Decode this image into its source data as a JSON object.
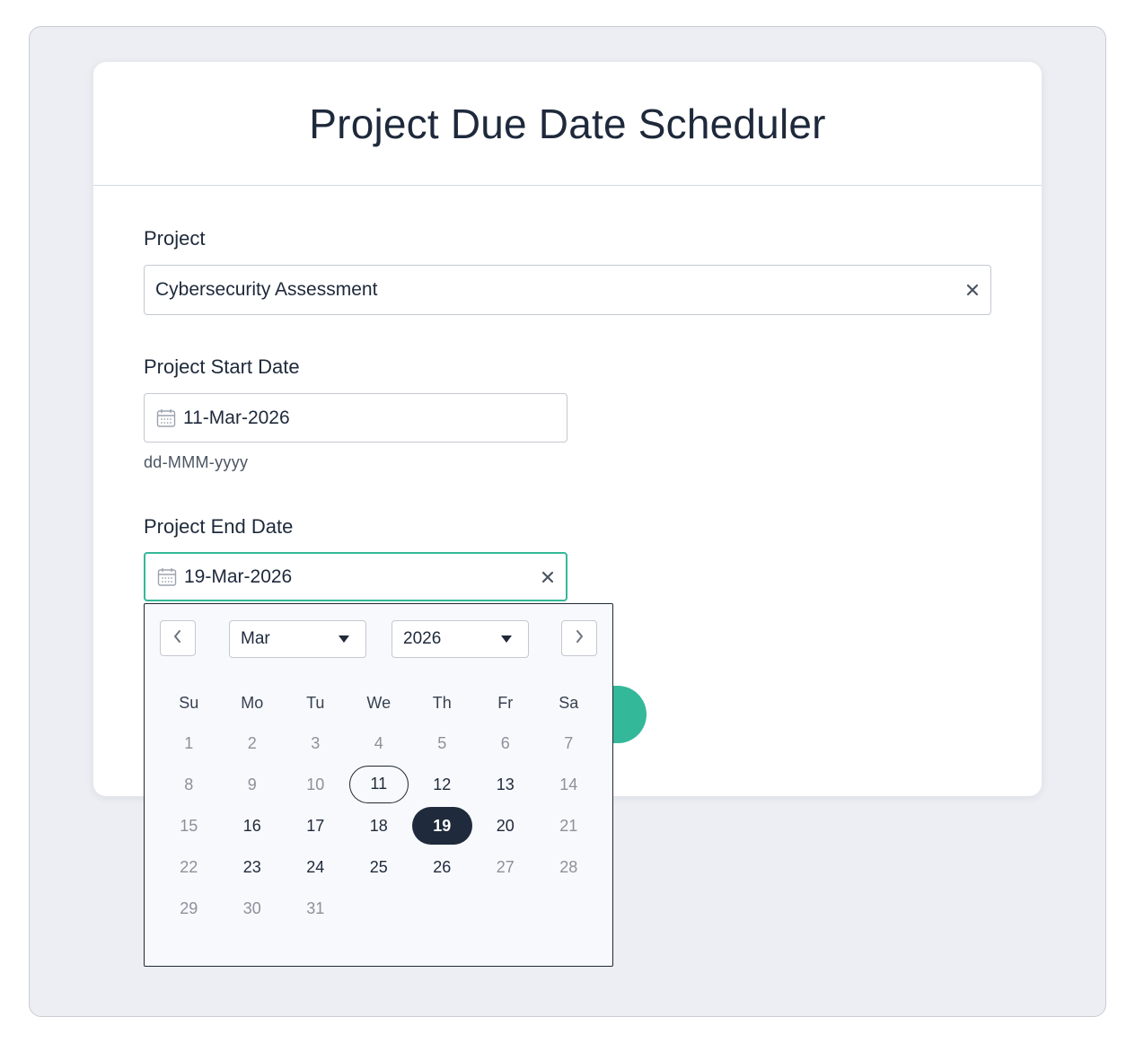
{
  "header": {
    "title": "Project Due Date Scheduler"
  },
  "form": {
    "project": {
      "label": "Project",
      "value": "Cybersecurity Assessment",
      "clear_icon": "close-icon"
    },
    "start_date": {
      "label": "Project Start Date",
      "value": "11-Mar-2026",
      "hint": "dd-MMM-yyyy",
      "icon": "calendar-icon"
    },
    "end_date": {
      "label": "Project End Date",
      "value": "19-Mar-2026",
      "icon": "calendar-icon",
      "clear_icon": "close-icon"
    }
  },
  "calendar": {
    "month": "Mar",
    "year": "2026",
    "weekdays": [
      "Su",
      "Mo",
      "Tu",
      "We",
      "Th",
      "Fr",
      "Sa"
    ],
    "weeks": [
      [
        {
          "d": "1",
          "s": "muted"
        },
        {
          "d": "2",
          "s": "muted"
        },
        {
          "d": "3",
          "s": "muted"
        },
        {
          "d": "4",
          "s": "muted"
        },
        {
          "d": "5",
          "s": "muted"
        },
        {
          "d": "6",
          "s": "muted"
        },
        {
          "d": "7",
          "s": "muted"
        }
      ],
      [
        {
          "d": "8",
          "s": "muted"
        },
        {
          "d": "9",
          "s": "muted"
        },
        {
          "d": "10",
          "s": "muted"
        },
        {
          "d": "11",
          "s": "today"
        },
        {
          "d": "12",
          "s": "active"
        },
        {
          "d": "13",
          "s": "active"
        },
        {
          "d": "14",
          "s": "muted"
        }
      ],
      [
        {
          "d": "15",
          "s": "muted"
        },
        {
          "d": "16",
          "s": "active"
        },
        {
          "d": "17",
          "s": "active"
        },
        {
          "d": "18",
          "s": "active"
        },
        {
          "d": "19",
          "s": "selected"
        },
        {
          "d": "20",
          "s": "active"
        },
        {
          "d": "21",
          "s": "muted"
        }
      ],
      [
        {
          "d": "22",
          "s": "muted"
        },
        {
          "d": "23",
          "s": "active"
        },
        {
          "d": "24",
          "s": "active"
        },
        {
          "d": "25",
          "s": "active"
        },
        {
          "d": "26",
          "s": "active"
        },
        {
          "d": "27",
          "s": "muted"
        },
        {
          "d": "28",
          "s": "muted"
        }
      ],
      [
        {
          "d": "29",
          "s": "muted"
        },
        {
          "d": "30",
          "s": "muted"
        },
        {
          "d": "31",
          "s": "muted"
        }
      ]
    ]
  },
  "colors": {
    "accent": "#34b89a",
    "selected": "#1f2a3c",
    "frame": "#eceef3"
  }
}
